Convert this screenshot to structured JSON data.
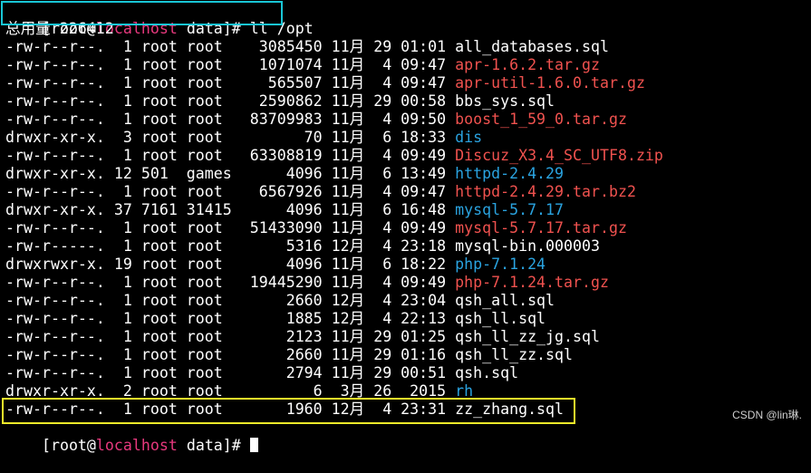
{
  "prompt": {
    "user": "[root@",
    "host": "localhost",
    "rest": " data]# ",
    "command": "ll /opt"
  },
  "total_line": "总用量 226412",
  "files": [
    {
      "perms": "-rw-r--r--.",
      "links": "1",
      "owner": "root",
      "group": "root",
      "size": "3085450",
      "month": "11月",
      "day": "29",
      "time": "01:01",
      "name": "all_databases.sql",
      "color": "white"
    },
    {
      "perms": "-rw-r--r--.",
      "links": "1",
      "owner": "root",
      "group": "root",
      "size": "1071074",
      "month": "11月",
      "day": "4",
      "time": "09:47",
      "name": "apr-1.6.2.tar.gz",
      "color": "red"
    },
    {
      "perms": "-rw-r--r--.",
      "links": "1",
      "owner": "root",
      "group": "root",
      "size": "565507",
      "month": "11月",
      "day": "4",
      "time": "09:47",
      "name": "apr-util-1.6.0.tar.gz",
      "color": "red"
    },
    {
      "perms": "-rw-r--r--.",
      "links": "1",
      "owner": "root",
      "group": "root",
      "size": "2590862",
      "month": "11月",
      "day": "29",
      "time": "00:58",
      "name": "bbs_sys.sql",
      "color": "white"
    },
    {
      "perms": "-rw-r--r--.",
      "links": "1",
      "owner": "root",
      "group": "root",
      "size": "83709983",
      "month": "11月",
      "day": "4",
      "time": "09:50",
      "name": "boost_1_59_0.tar.gz",
      "color": "red"
    },
    {
      "perms": "drwxr-xr-x.",
      "links": "3",
      "owner": "root",
      "group": "root",
      "size": "70",
      "month": "11月",
      "day": "6",
      "time": "18:33",
      "name": "dis",
      "color": "blue"
    },
    {
      "perms": "-rw-r--r--.",
      "links": "1",
      "owner": "root",
      "group": "root",
      "size": "63308819",
      "month": "11月",
      "day": "4",
      "time": "09:49",
      "name": "Discuz_X3.4_SC_UTF8.zip",
      "color": "red"
    },
    {
      "perms": "drwxr-xr-x.",
      "links": "12",
      "owner": "501",
      "group": "games",
      "size": "4096",
      "month": "11月",
      "day": "6",
      "time": "13:49",
      "name": "httpd-2.4.29",
      "color": "blue"
    },
    {
      "perms": "-rw-r--r--.",
      "links": "1",
      "owner": "root",
      "group": "root",
      "size": "6567926",
      "month": "11月",
      "day": "4",
      "time": "09:47",
      "name": "httpd-2.4.29.tar.bz2",
      "color": "red"
    },
    {
      "perms": "drwxr-xr-x.",
      "links": "37",
      "owner": "7161",
      "group": "31415",
      "size": "4096",
      "month": "11月",
      "day": "6",
      "time": "16:48",
      "name": "mysql-5.7.17",
      "color": "blue"
    },
    {
      "perms": "-rw-r--r--.",
      "links": "1",
      "owner": "root",
      "group": "root",
      "size": "51433090",
      "month": "11月",
      "day": "4",
      "time": "09:49",
      "name": "mysql-5.7.17.tar.gz",
      "color": "red"
    },
    {
      "perms": "-rw-r-----.",
      "links": "1",
      "owner": "root",
      "group": "root",
      "size": "5316",
      "month": "12月",
      "day": "4",
      "time": "23:18",
      "name": "mysql-bin.000003",
      "color": "white"
    },
    {
      "perms": "drwxrwxr-x.",
      "links": "19",
      "owner": "root",
      "group": "root",
      "size": "4096",
      "month": "11月",
      "day": "6",
      "time": "18:22",
      "name": "php-7.1.24",
      "color": "blue"
    },
    {
      "perms": "-rw-r--r--.",
      "links": "1",
      "owner": "root",
      "group": "root",
      "size": "19445290",
      "month": "11月",
      "day": "4",
      "time": "09:49",
      "name": "php-7.1.24.tar.gz",
      "color": "red"
    },
    {
      "perms": "-rw-r--r--.",
      "links": "1",
      "owner": "root",
      "group": "root",
      "size": "2660",
      "month": "12月",
      "day": "4",
      "time": "23:04",
      "name": "qsh_all.sql",
      "color": "white"
    },
    {
      "perms": "-rw-r--r--.",
      "links": "1",
      "owner": "root",
      "group": "root",
      "size": "1885",
      "month": "12月",
      "day": "4",
      "time": "22:13",
      "name": "qsh_ll.sql",
      "color": "white"
    },
    {
      "perms": "-rw-r--r--.",
      "links": "1",
      "owner": "root",
      "group": "root",
      "size": "2123",
      "month": "11月",
      "day": "29",
      "time": "01:25",
      "name": "qsh_ll_zz_jg.sql",
      "color": "white"
    },
    {
      "perms": "-rw-r--r--.",
      "links": "1",
      "owner": "root",
      "group": "root",
      "size": "2660",
      "month": "11月",
      "day": "29",
      "time": "01:16",
      "name": "qsh_ll_zz.sql",
      "color": "white"
    },
    {
      "perms": "-rw-r--r--.",
      "links": "1",
      "owner": "root",
      "group": "root",
      "size": "2794",
      "month": "11月",
      "day": "29",
      "time": "00:51",
      "name": "qsh.sql",
      "color": "white"
    },
    {
      "perms": "drwxr-xr-x.",
      "links": "2",
      "owner": "root",
      "group": "root",
      "size": "6",
      "month": "3月",
      "day": "26",
      "time": "2015",
      "name": "rh",
      "color": "blue"
    },
    {
      "perms": "-rw-r--r--.",
      "links": "1",
      "owner": "root",
      "group": "root",
      "size": "1960",
      "month": "12月",
      "day": "4",
      "time": "23:31",
      "name": "zz_zhang.sql",
      "color": "white"
    }
  ],
  "bottom_prompt": {
    "user": "[root@",
    "host": "localhost",
    "rest": " data]# "
  },
  "watermark": "CSDN @lin琳.",
  "colors": {
    "background": "#000000",
    "host_pink": "#e8397e",
    "archive_red": "#f0524f",
    "directory_blue": "#2aa3e0",
    "highlight_cyan": "#19c6d6",
    "highlight_yellow": "#f2ea2a"
  }
}
